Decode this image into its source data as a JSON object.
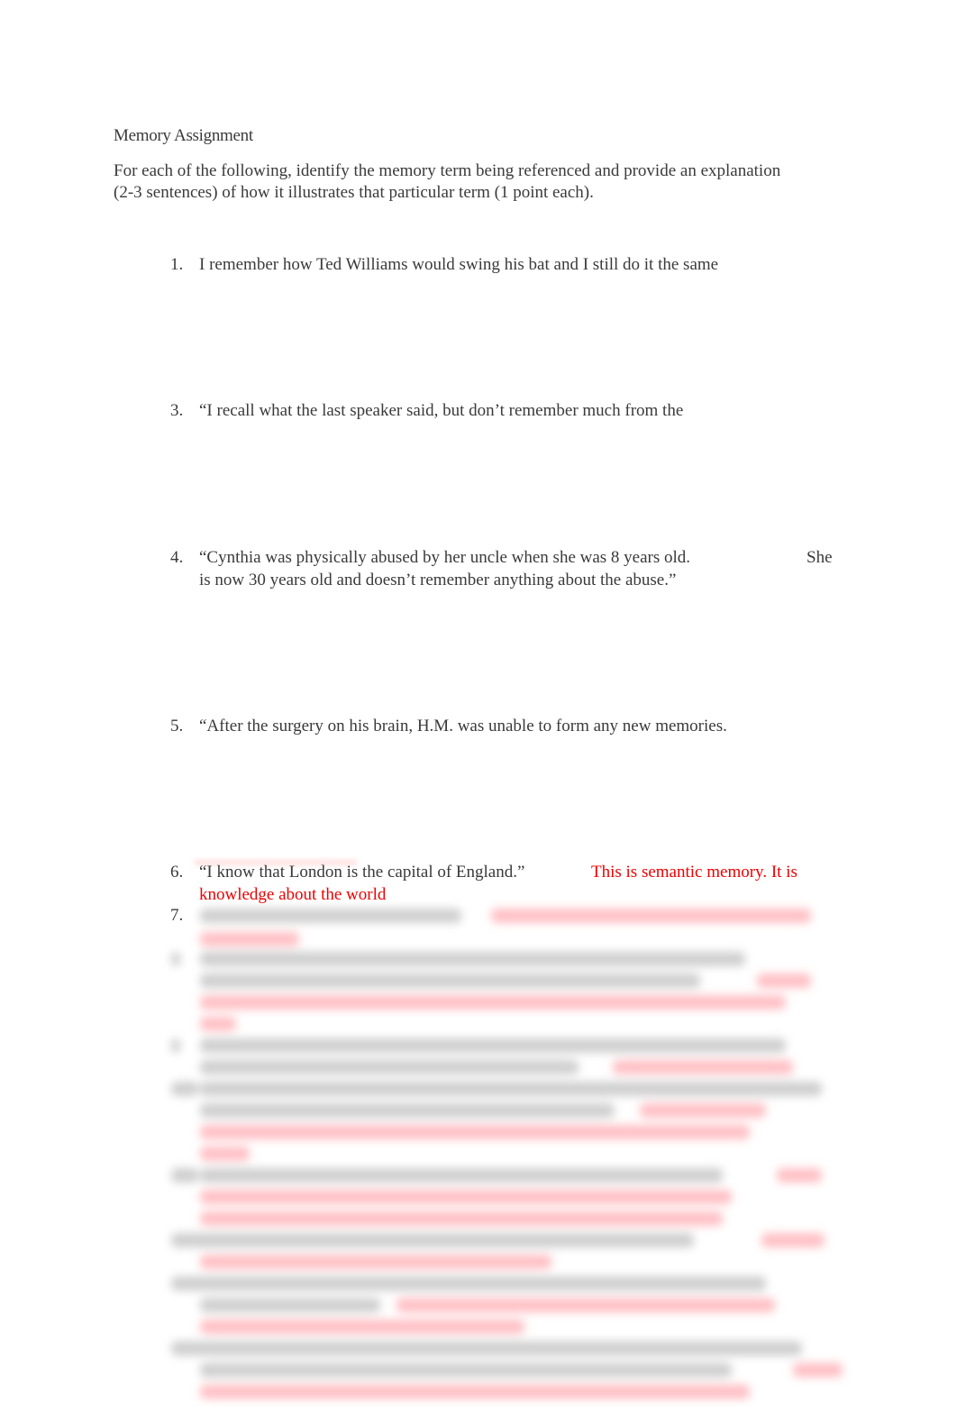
{
  "document": {
    "title": "Memory Assignment",
    "instructions": " For each of the following, identify the memory term being referenced and provide an explanation (2-3 sentences) of how it illustrates that particular term (1 point each).",
    "items": [
      {
        "number": "1.",
        "question": "I remember how Ted Williams would swing his bat and I still do it the same"
      },
      {
        "number": "3.",
        "question": "“I recall what the last speaker said, but don’t remember much from the"
      },
      {
        "number": "4.",
        "question": "“Cynthia was physically abused by her uncle when she was 8 years old.",
        "question_cont": "She",
        "question_line2": "is now 30 years old and doesn’t remember anything about the abuse.”"
      },
      {
        "number": "5.",
        "question": " “After the surgery on his brain, H.M. was unable to form any new memories."
      },
      {
        "number": "6.",
        "question": " “I know that London is the capital of England.”",
        "answer": "This is semantic memory. It is",
        "answer_line2": "knowledge about the world"
      },
      {
        "number": "7.",
        "question": "",
        "answer": ""
      }
    ],
    "blurred_note": "Remaining items (8-14) are blurred/obscured in the screenshot"
  },
  "colors": {
    "text": "#3a3a3a",
    "answer": "#ee0000"
  }
}
